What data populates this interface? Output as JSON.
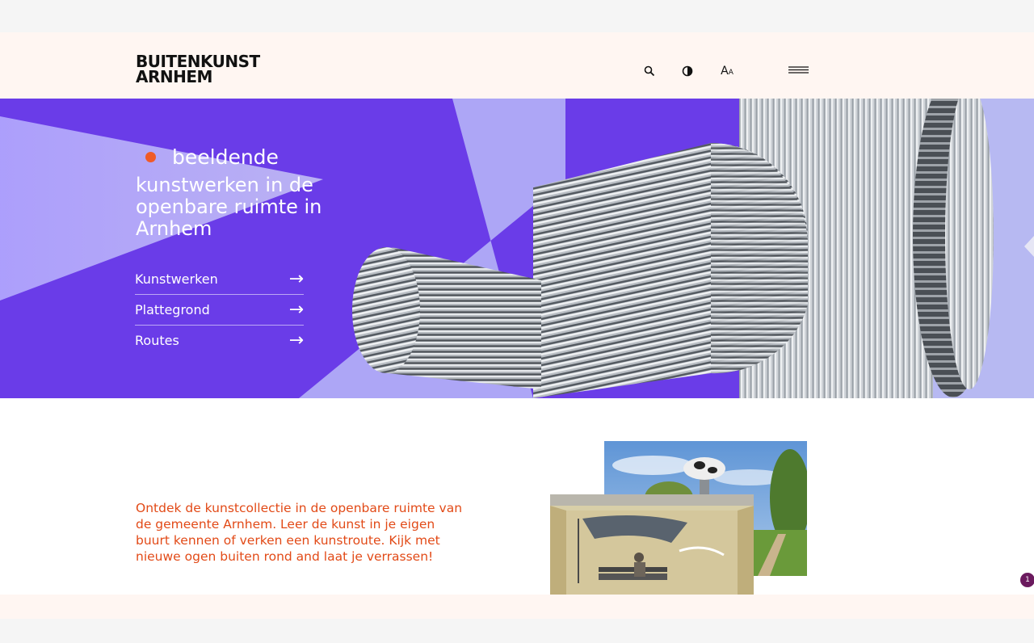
{
  "logo": {
    "line1": "BUITENKUNST",
    "line2": "ARNHEM"
  },
  "header": {
    "icons": [
      "search-icon",
      "contrast-icon",
      "font-size-icon",
      "menu-icon"
    ],
    "font_size_label": "AA"
  },
  "hero": {
    "tag": "beeldende",
    "title": "kunstwerken in de openbare ruimte in Arnhem",
    "links": [
      {
        "label": "Kunstwerken",
        "arrow": "→"
      },
      {
        "label": "Plattegrond",
        "arrow": "→"
      },
      {
        "label": "Routes",
        "arrow": "→"
      }
    ]
  },
  "intro": {
    "text": "Ontdek de kunstcollectie in de openbare ruimte van de gemeente Arnhem. Leer de kunst in je eigen buurt kennen of verken een kunstroute. Kijk met nieuwe ogen buiten rond and laat je verrassen!"
  },
  "badge": {
    "count": "1"
  },
  "colors": {
    "hero_purple": "#6a3ce8",
    "accent_orange": "#f05a28",
    "intro_text": "#e24a17",
    "header_bg": "#fff6f2"
  }
}
